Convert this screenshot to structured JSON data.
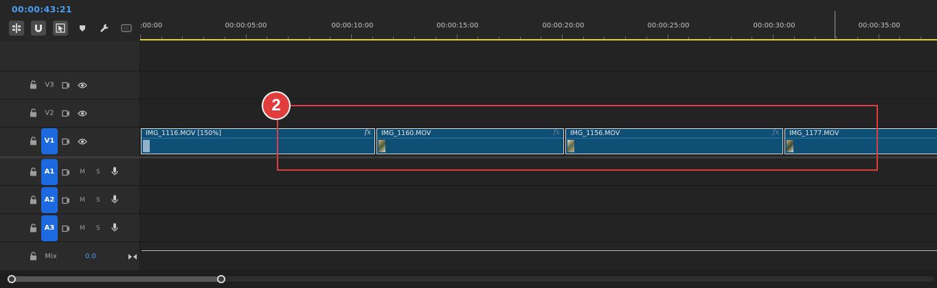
{
  "timecode": "00:00:43:21",
  "toolbar": {
    "icons": [
      "insert-nest-icon",
      "snap-magnet-icon",
      "linked-selection-icon",
      "add-marker-icon",
      "wrench-settings-icon",
      "captions-icon"
    ]
  },
  "ruler": {
    "labels": [
      ":00:00",
      "00:00:05:00",
      "00:00:10:00",
      "00:00:15:00",
      "00:00:20:00",
      "00:00:25:00",
      "00:00:30:00",
      "00:00:35:00"
    ]
  },
  "tracks": {
    "v3": {
      "name": "V3"
    },
    "v2": {
      "name": "V2"
    },
    "v1": {
      "name": "V1"
    },
    "a1": {
      "name": "A1",
      "mute": "M",
      "solo": "S"
    },
    "a2": {
      "name": "A2",
      "mute": "M",
      "solo": "S"
    },
    "a3": {
      "name": "A3",
      "mute": "M",
      "solo": "S"
    },
    "mix": {
      "name": "Mix",
      "value": "0.0"
    }
  },
  "clips": [
    {
      "title": "IMG_1116.MOV [150%]",
      "fx": "fx"
    },
    {
      "title": "IMG_1160.MOV",
      "fx": "fx"
    },
    {
      "title": "IMG_1156.MOV",
      "fx": "fx"
    },
    {
      "title": "IMG_1177.MOV",
      "fx": ""
    }
  ],
  "annotation": {
    "badge": "2"
  },
  "colors": {
    "accent": "#4a9dee",
    "active_track": "#1d6ae0",
    "clip_fill": "#0f4f76",
    "work_area": "#e6d521",
    "annotation": "#e23d3d"
  }
}
